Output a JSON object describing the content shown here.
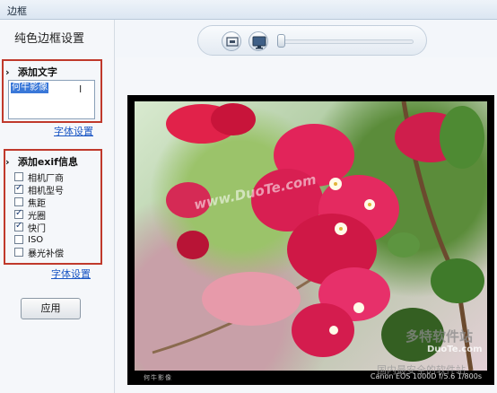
{
  "window": {
    "title": "边框"
  },
  "left_panel": {
    "title": "纯色边框设置",
    "text_section": {
      "header": "添加文字",
      "text_value": "何牛影像",
      "font_link": "字体设置"
    },
    "exif_section": {
      "header": "添加exif信息",
      "items": [
        {
          "label": "相机厂商",
          "checked": false
        },
        {
          "label": "相机型号",
          "checked": true
        },
        {
          "label": "焦距",
          "checked": false
        },
        {
          "label": "光圈",
          "checked": true
        },
        {
          "label": "快门",
          "checked": true
        },
        {
          "label": "ISO",
          "checked": false
        },
        {
          "label": "暴光补偿",
          "checked": false
        }
      ],
      "font_link": "字体设置"
    },
    "apply_label": "应用"
  },
  "photo": {
    "footer_left": "何牛影像",
    "footer_right": "Canon EOS 1000D  f/5.6  1/800s"
  },
  "watermark": {
    "brand": "多特软件站",
    "url": "DuoTe.com",
    "slogan": "国内最安全的软件站",
    "mid": "www.DuoTe.com"
  },
  "colors": {
    "highlight_box": "#c0392b",
    "link": "#1a56c4",
    "selection": "#3a78d8"
  }
}
